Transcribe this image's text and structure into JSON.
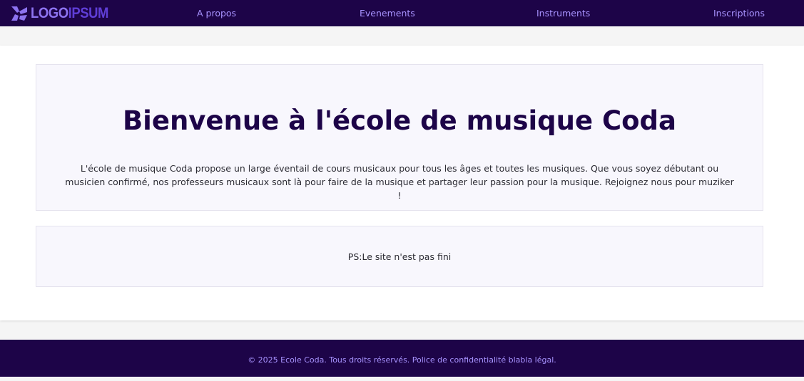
{
  "header": {
    "logo": {
      "icon": "logoipsum-mark-icon",
      "text_part1": "LOGO",
      "text_part2": "IPSUM"
    },
    "nav": [
      {
        "label": "A propos"
      },
      {
        "label": "Evenements"
      },
      {
        "label": "Instruments"
      },
      {
        "label": "Inscriptions"
      }
    ]
  },
  "hero": {
    "title": "Bienvenue à l'école de musique Coda",
    "description": "L'école de musique Coda propose un large éventail de cours musicaux pour tous les âges et toutes les musiques. Que vous soyez débutant ou musicien confirmé, nos professeurs musicaux sont là pour faire de la musique et partager leur passion pour la musique. Rejoignez nous pour muziker !"
  },
  "note": {
    "text": "PS:Le site n'est pas fini"
  },
  "footer": {
    "text": "© 2025 Ecole Coda. Tous droits réservés. Police de confidentialité blabla légal."
  },
  "colors": {
    "primary_dark": "#1d0448",
    "accent": "#a893ff",
    "card_background": "#f8f7fd"
  }
}
